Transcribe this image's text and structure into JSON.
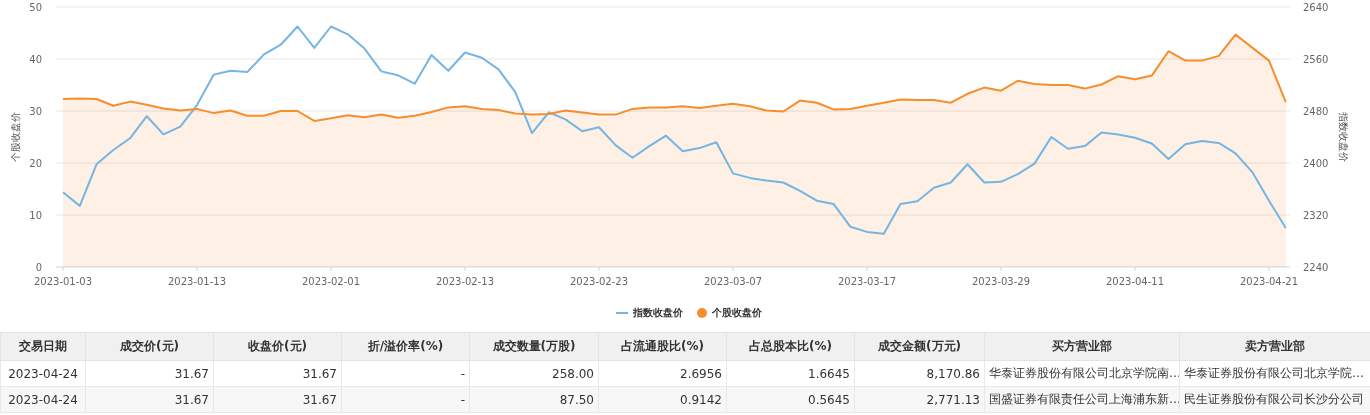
{
  "chart": {
    "chart_data": {
      "type": "line",
      "grid": true,
      "legend": "bottom",
      "ylabel": "个股收盘价",
      "y2label": "指数收盘价",
      "ylim": [
        0,
        50
      ],
      "yticks": [
        0,
        10,
        20,
        30,
        40,
        50
      ],
      "y2lim": [
        2240,
        2640
      ],
      "y2ticks": [
        2240,
        2320,
        2400,
        2480,
        2560,
        2640
      ],
      "categories": [
        "2023-01-03",
        null,
        null,
        null,
        null,
        null,
        null,
        null,
        "2023-01-13",
        null,
        null,
        null,
        null,
        null,
        null,
        null,
        "2023-02-01",
        null,
        null,
        null,
        null,
        null,
        null,
        null,
        "2023-02-13",
        null,
        null,
        null,
        null,
        null,
        null,
        null,
        "2023-02-23",
        null,
        null,
        null,
        null,
        null,
        null,
        null,
        "2023-03-07",
        null,
        null,
        null,
        null,
        null,
        null,
        null,
        "2023-03-17",
        null,
        null,
        null,
        null,
        null,
        null,
        null,
        "2023-03-29",
        null,
        null,
        null,
        null,
        null,
        null,
        null,
        "2023-04-11",
        null,
        null,
        null,
        null,
        null,
        null,
        null,
        "2023-04-21",
        null
      ],
      "series": [
        {
          "name": "指数收盘价",
          "type": "line",
          "axis": "y2",
          "color": "#74b5e4",
          "values": [
            2355,
            2334,
            2398,
            2420,
            2438,
            2472,
            2444,
            2456,
            2489,
            2536,
            2542,
            2540,
            2567,
            2582,
            2610,
            2577,
            2610,
            2598,
            2576,
            2541,
            2535,
            2522,
            2566,
            2542,
            2570,
            2562,
            2544,
            2509,
            2446,
            2478,
            2467,
            2449,
            2455,
            2427,
            2408,
            2426,
            2442,
            2418,
            2423,
            2432,
            2384,
            2377,
            2373,
            2370,
            2357,
            2342,
            2337,
            2302,
            2294,
            2291,
            2337,
            2341,
            2362,
            2370,
            2398,
            2370,
            2371,
            2383,
            2399,
            2440,
            2422,
            2426,
            2447,
            2444,
            2439,
            2430,
            2406,
            2429,
            2434,
            2431,
            2415,
            2386,
            2342,
            2300
          ]
        },
        {
          "name": "个股收盘价",
          "type": "area",
          "color": "#f68d2e",
          "values": [
            32.3,
            32.4,
            32.3,
            31.0,
            31.8,
            31.2,
            30.5,
            30.1,
            30.4,
            29.6,
            30.1,
            29.1,
            29.1,
            30.0,
            30.0,
            28.1,
            28.6,
            29.2,
            28.8,
            29.3,
            28.7,
            29.1,
            29.8,
            30.7,
            30.9,
            30.4,
            30.2,
            29.5,
            29.3,
            29.4,
            30.1,
            29.7,
            29.3,
            29.3,
            30.4,
            30.7,
            30.7,
            30.9,
            30.6,
            31.0,
            31.4,
            30.9,
            30.1,
            29.9,
            32.0,
            31.6,
            30.3,
            30.4,
            31.0,
            31.6,
            32.2,
            32.1,
            32.1,
            31.6,
            33.3,
            34.5,
            33.9,
            35.8,
            35.2,
            35.0,
            35.0,
            34.3,
            35.1,
            36.7,
            36.1,
            36.8,
            41.5,
            39.7,
            39.7,
            40.6,
            44.7,
            42.2,
            39.7,
            31.7
          ]
        }
      ]
    }
  },
  "table": {
    "columns": [
      {
        "label": "交易日期",
        "kind": "date"
      },
      {
        "label": "成交价(元)",
        "kind": "number"
      },
      {
        "label": "收盘价(元)",
        "kind": "number"
      },
      {
        "label": "折/溢价率(%)",
        "kind": "number"
      },
      {
        "label": "成交数量(万股)",
        "kind": "number"
      },
      {
        "label": "占流通股比(%)",
        "kind": "number"
      },
      {
        "label": "占总股本比(%)",
        "kind": "number"
      },
      {
        "label": "成交金额(万元)",
        "kind": "number"
      },
      {
        "label": "买方营业部",
        "kind": "text"
      },
      {
        "label": "卖方营业部",
        "kind": "text"
      }
    ],
    "rows": [
      [
        "2023-04-24",
        "31.67",
        "31.67",
        "-",
        "258.00",
        "2.6956",
        "1.6645",
        "8,170.86",
        "华泰证券股份有限公司北京学院南…",
        "华泰证券股份有限公司北京学院…"
      ],
      [
        "2023-04-24",
        "31.67",
        "31.67",
        "-",
        "87.50",
        "0.9142",
        "0.5645",
        "2,771.13",
        "国盛证券有限责任公司上海浦东新…",
        "民生证券股份有限公司长沙分公司"
      ]
    ]
  }
}
